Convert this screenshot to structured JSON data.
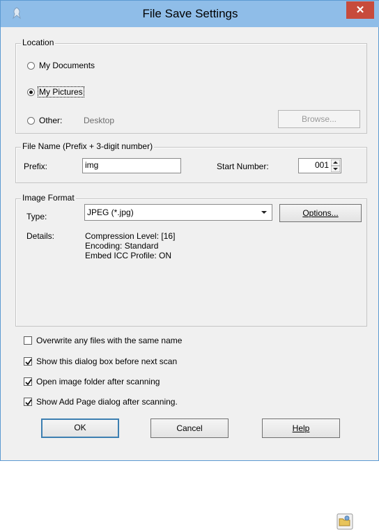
{
  "window": {
    "title": "File Save Settings",
    "close_glyph": "✕"
  },
  "location": {
    "legend": "Location",
    "options": [
      {
        "label": "My Documents",
        "selected": false
      },
      {
        "label": "My Pictures",
        "selected": true
      },
      {
        "label": "Other:",
        "selected": false
      }
    ],
    "other_path": "Desktop",
    "browse_label": "Browse..."
  },
  "file_name": {
    "legend": "File Name (Prefix + 3-digit number)",
    "prefix_label": "Prefix:",
    "prefix_value": "img",
    "start_number_label": "Start Number:",
    "start_number_value": "001"
  },
  "image_format": {
    "legend": "Image Format",
    "type_label": "Type:",
    "type_value": "JPEG (*.jpg)",
    "options_label": "Options...",
    "details_label": "Details:",
    "details": [
      "Compression Level: [16]",
      "Encoding: Standard",
      "Embed ICC Profile: ON"
    ]
  },
  "checkboxes": [
    {
      "label": "Overwrite any files with the same name",
      "checked": false
    },
    {
      "label": "Show this dialog box before next scan",
      "checked": true
    },
    {
      "label": "Open image folder after scanning",
      "checked": true
    },
    {
      "label": "Show Add Page dialog after scanning.",
      "checked": true
    }
  ],
  "buttons": {
    "ok": "OK",
    "cancel": "Cancel",
    "help": "Help"
  },
  "icons": {
    "app": "scanner-icon",
    "close": "close-icon",
    "dropdown": "chevron-down-icon",
    "spinner": "spinner-arrows-icon",
    "bottom": "folder-image-icon"
  },
  "colors": {
    "titlebar": "#8fbde8",
    "close": "#c74b3c",
    "dialog_bg": "#f0f0f0"
  }
}
